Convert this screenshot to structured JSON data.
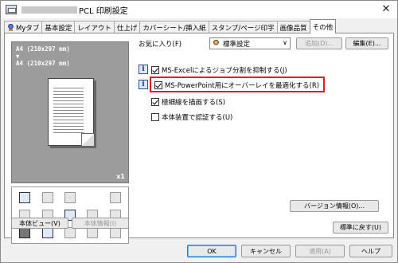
{
  "window": {
    "title": "PCL 印刷設定",
    "close_glyph": "✕"
  },
  "tabs": [
    {
      "label": "Myタブ",
      "active": false,
      "has_icon": true
    },
    {
      "label": "基本設定",
      "active": false
    },
    {
      "label": "レイアウト",
      "active": false
    },
    {
      "label": "仕上げ",
      "active": false
    },
    {
      "label": "カバーシート/挿入紙",
      "active": false
    },
    {
      "label": "スタンプ/ページ印字",
      "active": false
    },
    {
      "label": "画像品質",
      "active": false
    },
    {
      "label": "その他",
      "active": true
    }
  ],
  "preview": {
    "line1": "A4 (210x297 mm)",
    "arrow": "▼",
    "line2": "A4 (210x297 mm)",
    "copies": "x1"
  },
  "left_buttons": {
    "printer_view": "本体ビュー(V)",
    "printer_info": "本体情報(I)"
  },
  "favorites": {
    "label": "お気に入り(F)",
    "selected": "標準設定",
    "add": "追加(D)...",
    "edit": "編集(E)..."
  },
  "options": [
    {
      "label": "MS-Excelによるジョブ分割を抑制する(J)",
      "checked": true,
      "info": true
    },
    {
      "label": "MS-PowerPoint用にオーバーレイを最適化する(R)",
      "checked": true,
      "info": true,
      "highlighted": true
    },
    {
      "label": "極細線を描画する(S)",
      "checked": true,
      "info": false
    },
    {
      "label": "本体装置で認証する(U)",
      "checked": false,
      "info": false
    }
  ],
  "info_glyph": "i",
  "version_button": "バージョン情報(O)...",
  "reset_button": "標準に戻す(U)",
  "dialog_buttons": {
    "ok": "OK",
    "cancel": "キャンセル",
    "apply": "適用(A)",
    "help": "ヘルプ"
  },
  "colors": {
    "highlight": "#e0201f",
    "preview_bg": "#9c9c9c",
    "ok_border": "#2a74d2"
  }
}
